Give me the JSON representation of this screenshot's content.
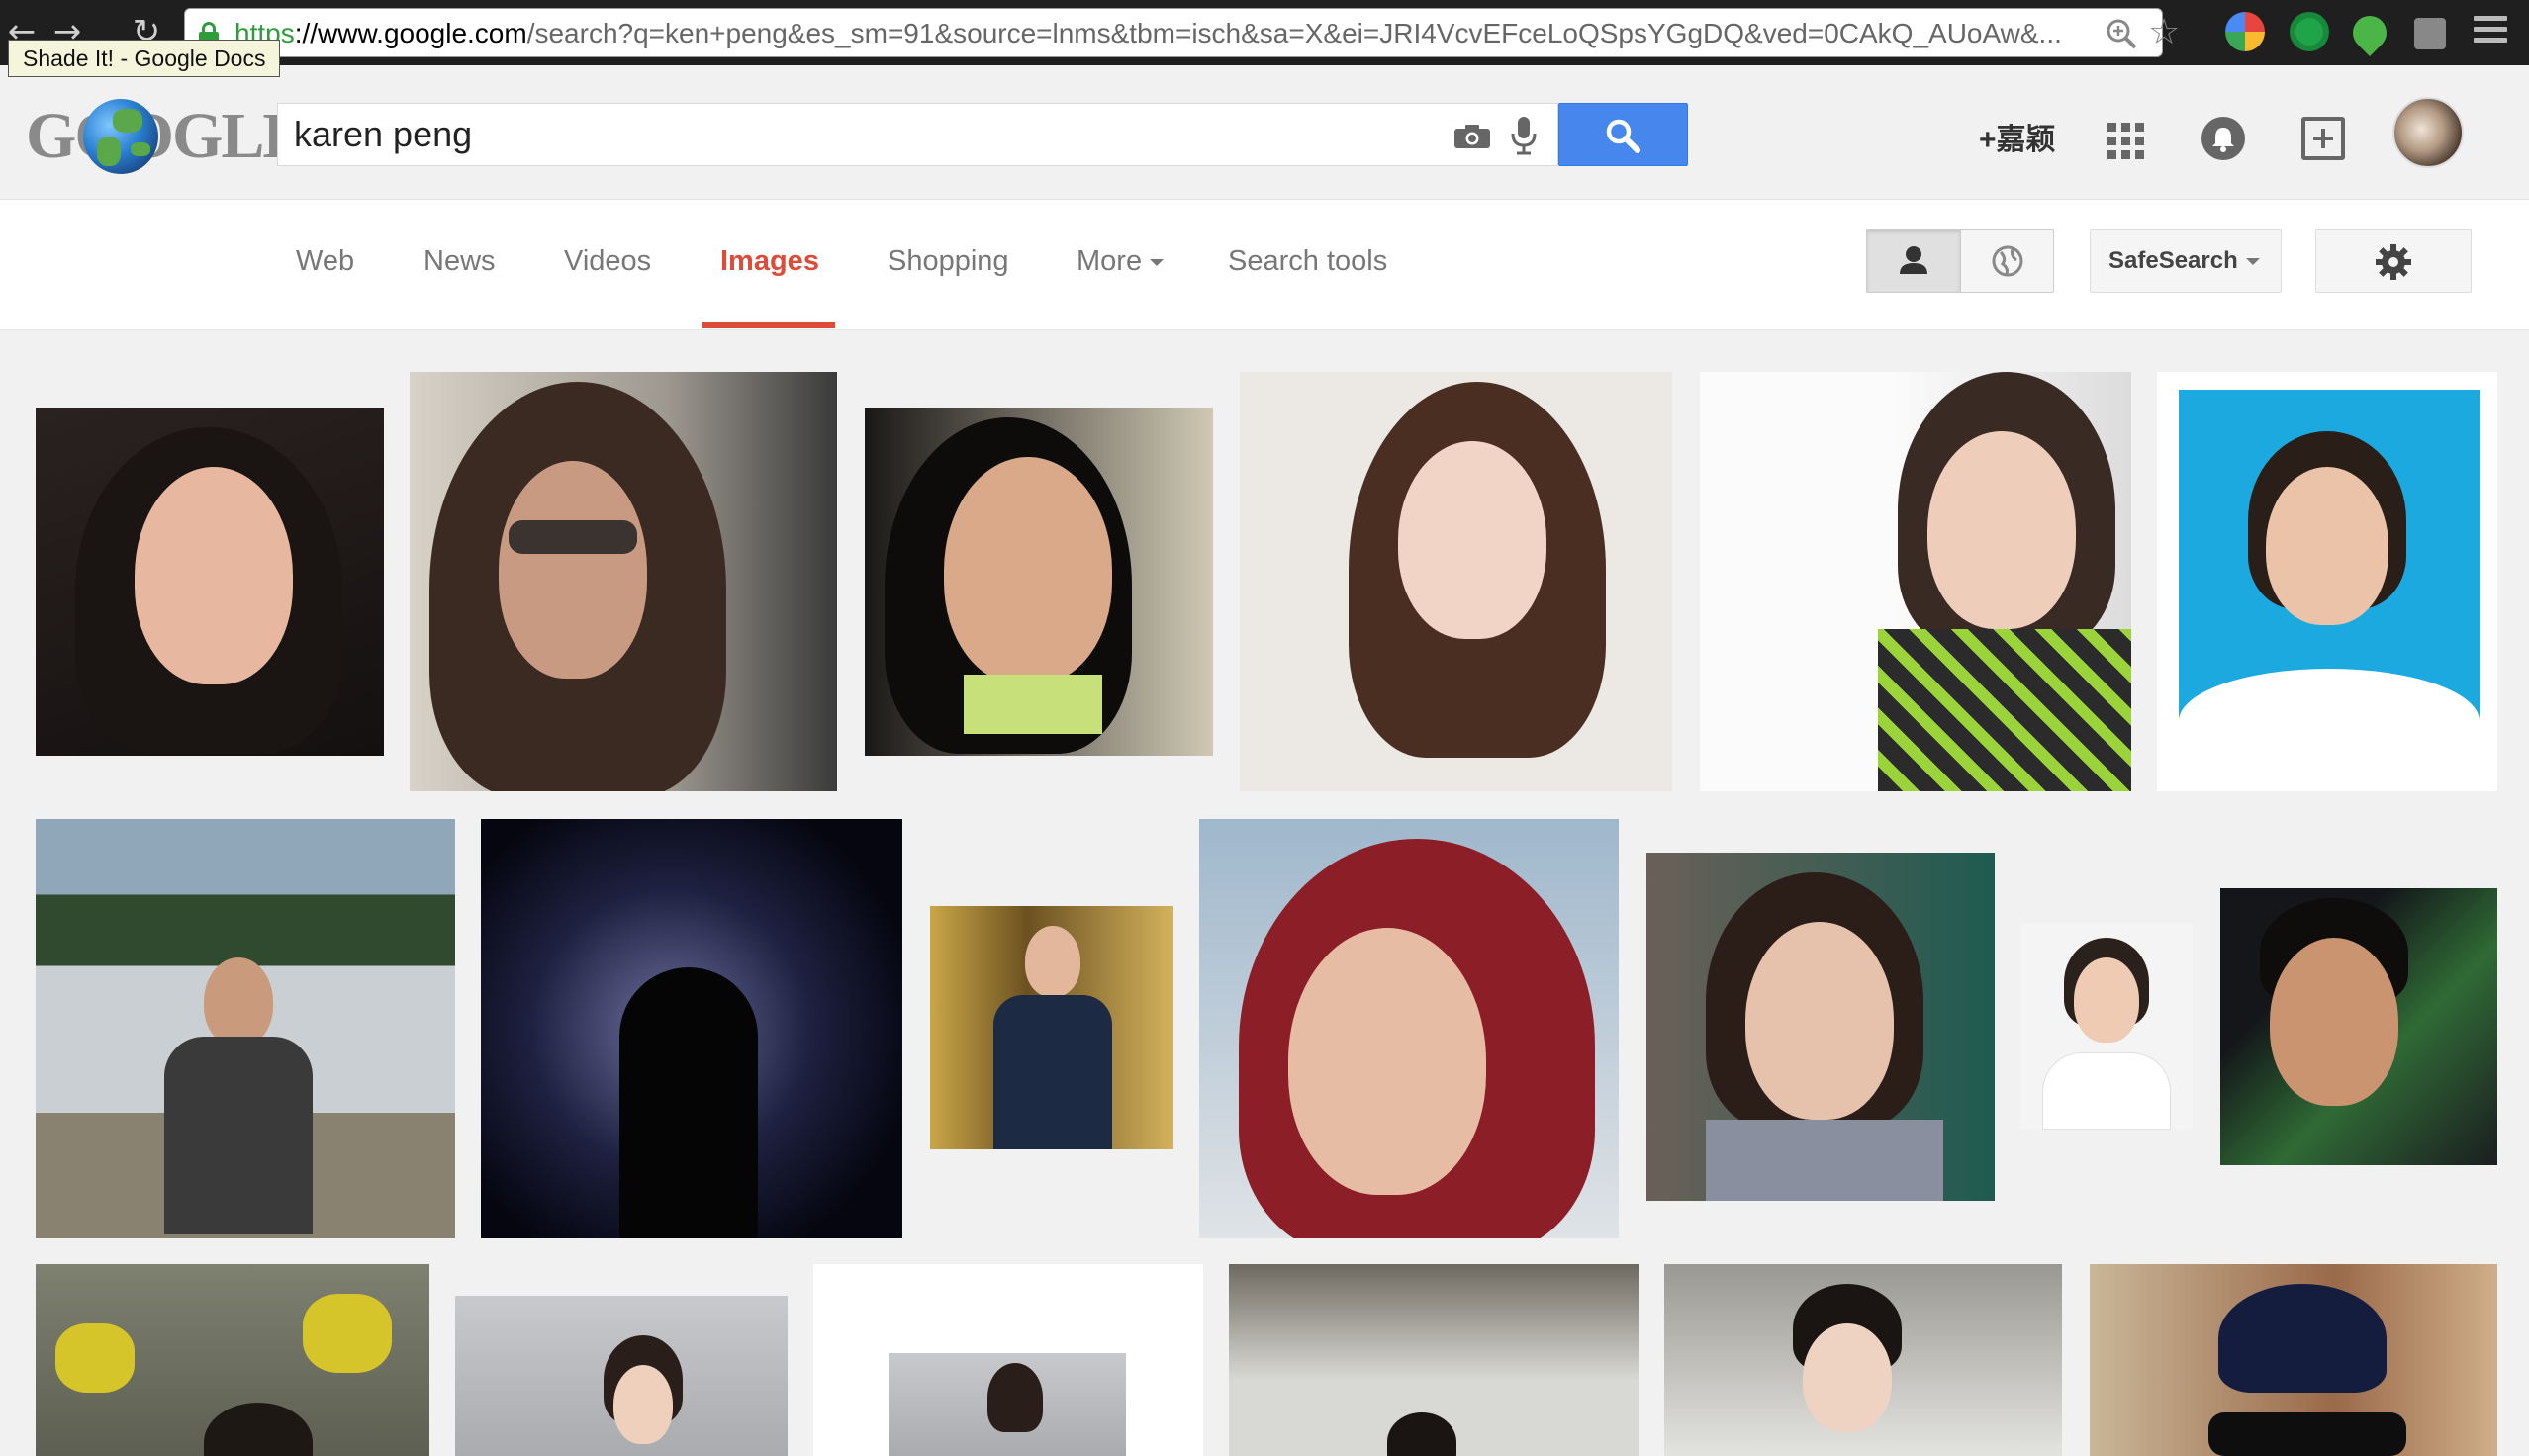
{
  "browser": {
    "url_scheme": "https",
    "url_domain": "://www.google.com",
    "url_rest": "/search?q=ken+peng&es_sm=91&source=lnms&tbm=isch&sa=X&ei=JRI4VcvEFceLoQSpsYGgDQ&ved=0CAkQ_AUoAw&...",
    "tooltip": "Shade It! - Google Docs"
  },
  "header": {
    "logo_text": "GOOGLE",
    "search_value": "karen peng",
    "user_link": "+嘉颖"
  },
  "tabs": [
    {
      "label": "Web",
      "active": false
    },
    {
      "label": "News",
      "active": false
    },
    {
      "label": "Videos",
      "active": false
    },
    {
      "label": "Images",
      "active": true
    },
    {
      "label": "Shopping",
      "active": false
    },
    {
      "label": "More",
      "active": false
    },
    {
      "label": "Search tools",
      "active": false
    }
  ],
  "tools": {
    "safesearch_label": "SafeSearch"
  },
  "colors": {
    "accent": "#dd4b39",
    "search_button": "#4787ed",
    "secure_green": "#2e9c3a"
  },
  "icons": [
    "back-icon",
    "forward-icon",
    "reload-icon",
    "lock-icon",
    "zoom-icon",
    "star-icon",
    "camera-icon",
    "microphone-icon",
    "search-icon",
    "apps-icon",
    "notifications-icon",
    "share-icon",
    "person-icon",
    "globe-icon",
    "gear-icon"
  ]
}
